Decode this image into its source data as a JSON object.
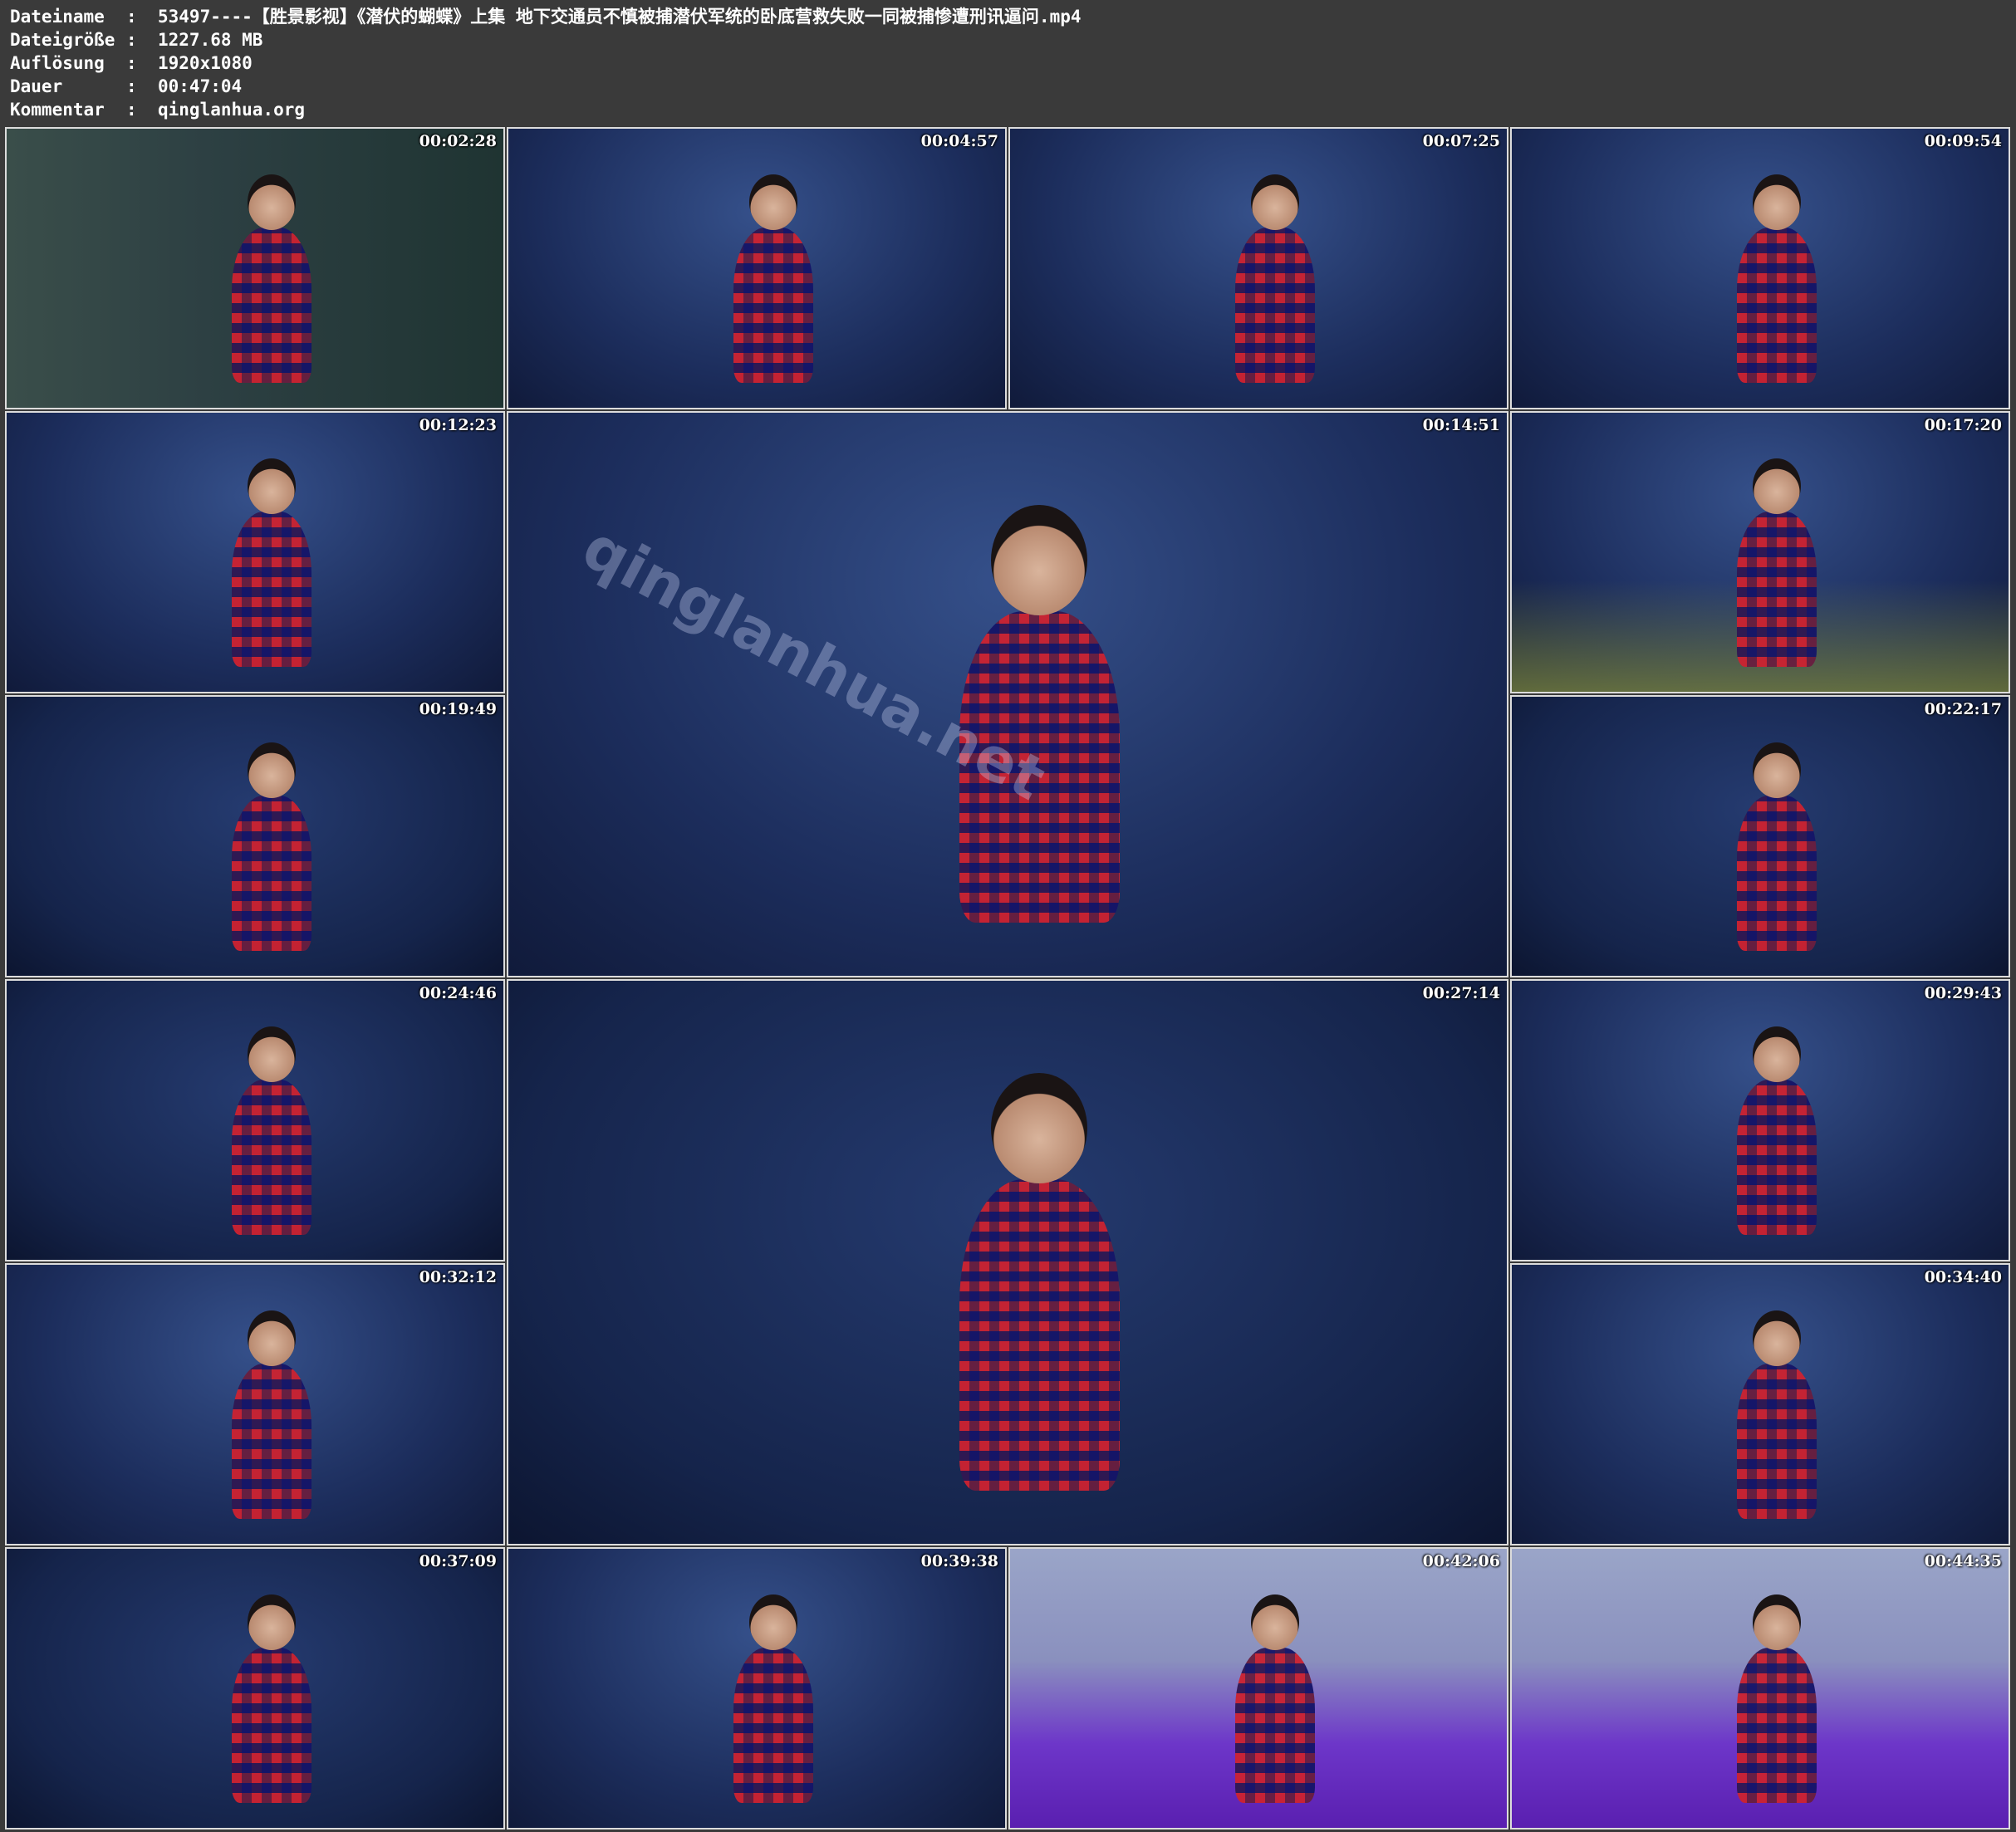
{
  "info": {
    "rows": [
      {
        "key": "Dateiname",
        "value": "53497----【胜景影视】《潜伏的蝴蝶》上集 地下交通员不慎被捕潜伏军统的卧底营救失败一同被捕惨遭刑讯逼问.mp4"
      },
      {
        "key": "Dateigröße",
        "value": "1227.68 MB"
      },
      {
        "key": "Auflösung",
        "value": "1920x1080"
      },
      {
        "key": "Dauer",
        "value": "00:47:04"
      },
      {
        "key": "Kommentar",
        "value": "qinglanhua.org"
      }
    ],
    "separator": ":"
  },
  "thumbnails": [
    {
      "timestamp": "00:02:28",
      "scene": "office"
    },
    {
      "timestamp": "00:04:57",
      "scene": "cell"
    },
    {
      "timestamp": "00:07:25",
      "scene": "cell"
    },
    {
      "timestamp": "00:09:54",
      "scene": "cell"
    },
    {
      "timestamp": "00:12:23",
      "scene": "cell"
    },
    {
      "timestamp": "00:14:51",
      "scene": "cell",
      "watermark": "qinglanhua.net"
    },
    {
      "timestamp": "00:17:20",
      "scene": "floor"
    },
    {
      "timestamp": "00:19:49",
      "scene": "dark"
    },
    {
      "timestamp": "00:22:17",
      "scene": "dark"
    },
    {
      "timestamp": "00:24:46",
      "scene": "dark"
    },
    {
      "timestamp": "00:27:14",
      "scene": "dark"
    },
    {
      "timestamp": "00:29:43",
      "scene": "cell"
    },
    {
      "timestamp": "00:32:12",
      "scene": "cell"
    },
    {
      "timestamp": "00:34:40",
      "scene": "cell"
    },
    {
      "timestamp": "00:37:09",
      "scene": "dark"
    },
    {
      "timestamp": "00:39:38",
      "scene": "cell"
    },
    {
      "timestamp": "00:42:06",
      "scene": "bed"
    },
    {
      "timestamp": "00:44:35",
      "scene": "bed"
    }
  ]
}
